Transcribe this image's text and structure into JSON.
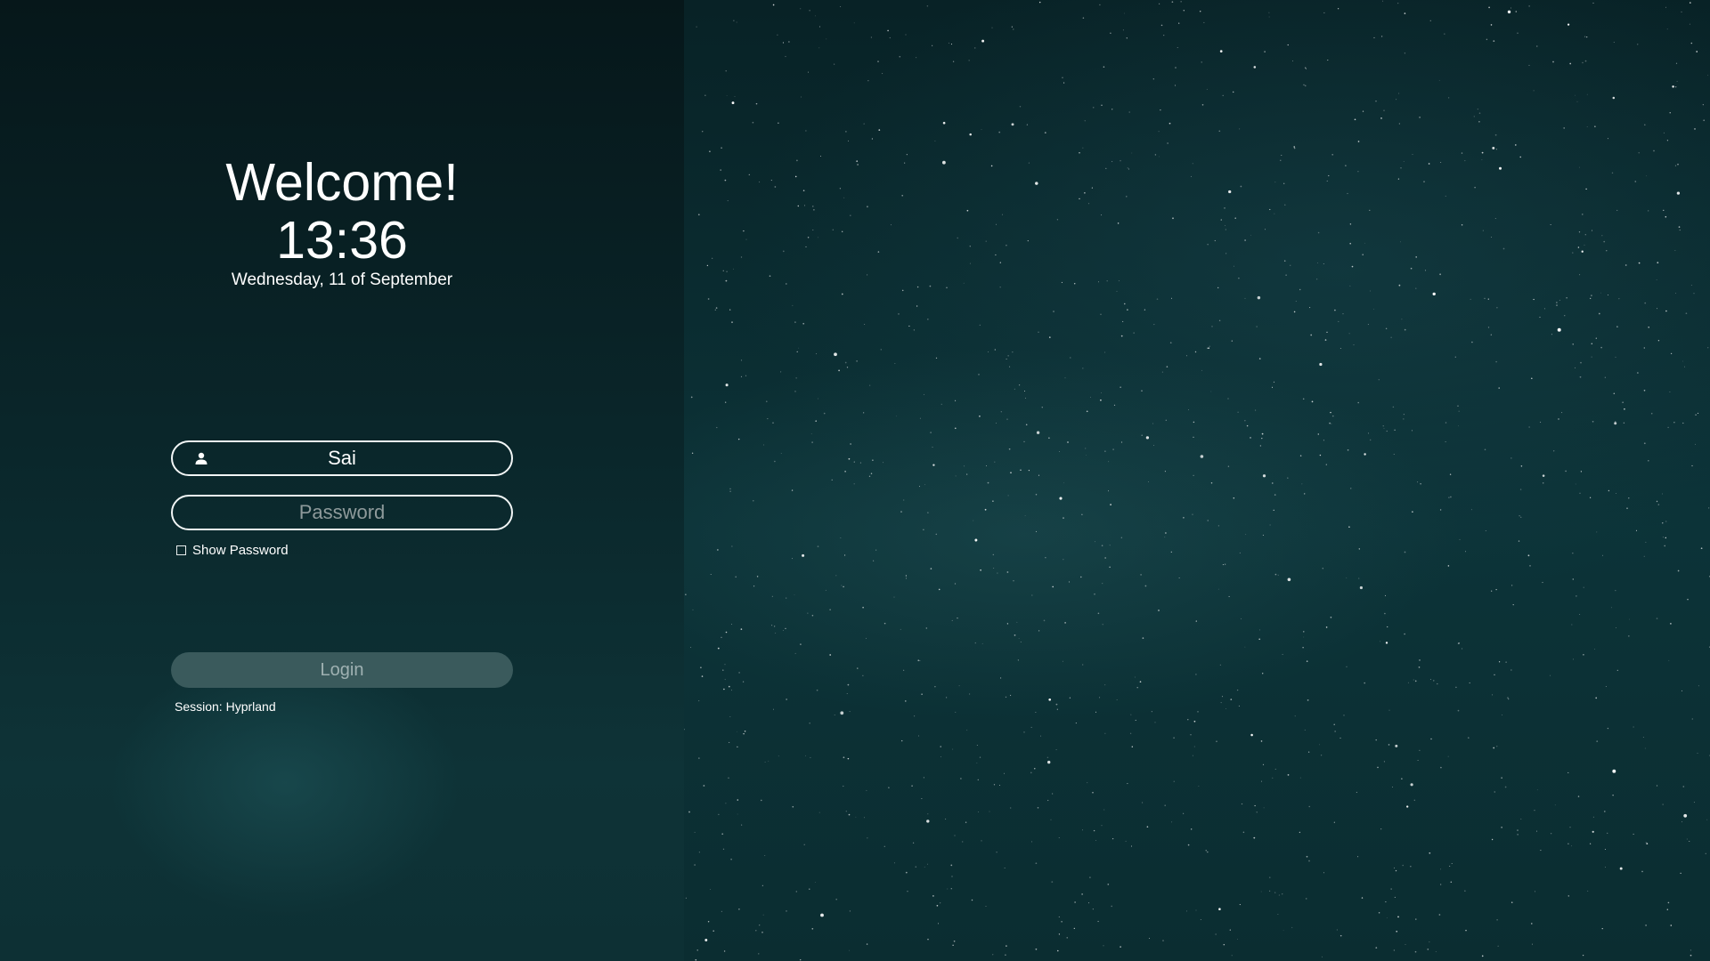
{
  "greeting": {
    "title": "Welcome!",
    "time": "13:36",
    "date": "Wednesday, 11 of September"
  },
  "login_form": {
    "username_value": "Sai",
    "password_placeholder": "Password",
    "show_password_label": "Show Password",
    "show_password_checked": false,
    "login_label": "Login",
    "session_prefix": "Session: ",
    "session_name": "Hyprland"
  },
  "icons": {
    "user": "user-icon",
    "checkbox": "checkbox-icon"
  },
  "colors": {
    "background": "#0b2d31",
    "panel_top": "#06171a",
    "field_border": "#f2f6f6",
    "login_button": "#3a5a5c",
    "login_text": "#9fb1b2",
    "placeholder": "#8e9a9b"
  }
}
